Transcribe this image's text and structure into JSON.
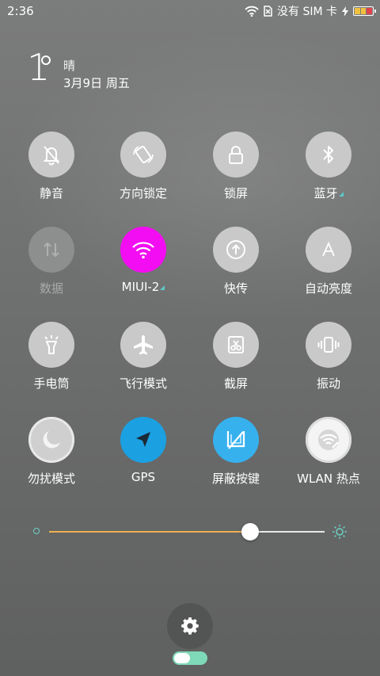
{
  "status_bar": {
    "time": "2:36",
    "carrier": "没有 SIM 卡",
    "battery_color": "#f0c040"
  },
  "weather": {
    "temperature": "1",
    "condition": "晴",
    "date": "3月9日 周五"
  },
  "tiles": [
    {
      "label": "静音",
      "icon": "silent-bell-icon",
      "state": "off"
    },
    {
      "label": "方向锁定",
      "icon": "rotation-lock-icon",
      "state": "off"
    },
    {
      "label": "锁屏",
      "icon": "lock-icon",
      "state": "off"
    },
    {
      "label": "蓝牙",
      "icon": "bluetooth-icon",
      "state": "off",
      "has_submenu": true
    },
    {
      "label": "数据",
      "icon": "mobile-data-icon",
      "state": "disabled"
    },
    {
      "label": "MIUI-2",
      "icon": "wifi-icon",
      "state": "on",
      "color": "#f20df2",
      "has_submenu": true
    },
    {
      "label": "快传",
      "icon": "quick-transfer-icon",
      "state": "off"
    },
    {
      "label": "自动亮度",
      "icon": "auto-brightness-icon",
      "state": "off"
    },
    {
      "label": "手电筒",
      "icon": "flashlight-icon",
      "state": "off"
    },
    {
      "label": "飞行模式",
      "icon": "airplane-icon",
      "state": "off"
    },
    {
      "label": "截屏",
      "icon": "screenshot-icon",
      "state": "off"
    },
    {
      "label": "振动",
      "icon": "vibrate-icon",
      "state": "off"
    },
    {
      "label": "勿扰模式",
      "icon": "moon-icon",
      "state": "off"
    },
    {
      "label": "GPS",
      "icon": "gps-arrow-icon",
      "state": "on",
      "color": "#1ba0e2"
    },
    {
      "label": "屏蔽按键",
      "icon": "block-keys-icon",
      "state": "on",
      "color": "#36b1ee"
    },
    {
      "label": "WLAN 热点",
      "icon": "wlan-hotspot-icon",
      "state": "off"
    }
  ],
  "brightness": {
    "level": 0.73,
    "filled_color": "#f0b04e",
    "low_icon_color": "#6dd2c4"
  },
  "settings": {
    "icon": "gear-icon",
    "toggle_color": "#7ed9b8"
  }
}
